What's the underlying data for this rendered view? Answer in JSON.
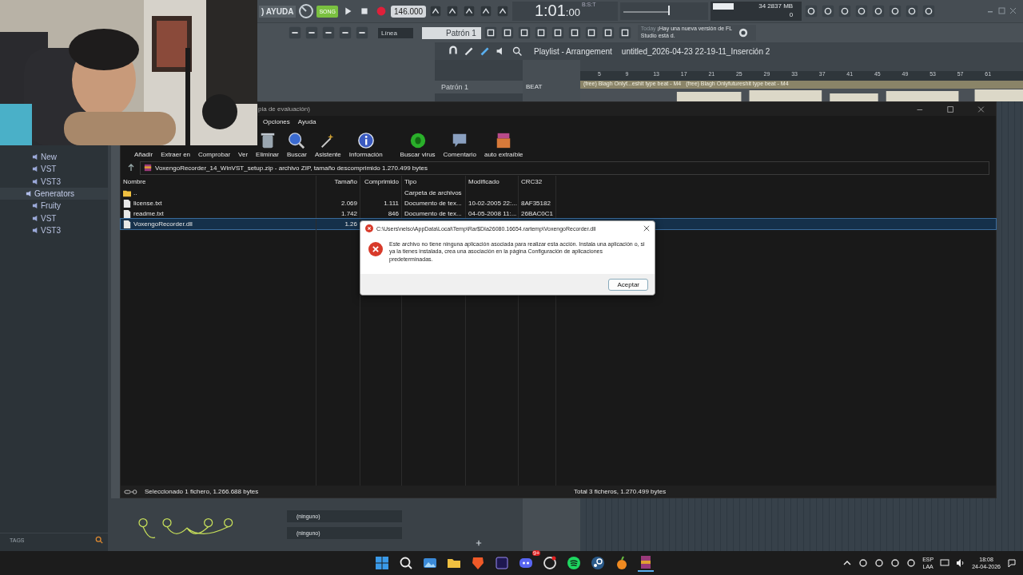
{
  "fl_studio": {
    "menu_tail": ") AYUDA",
    "song_mode": "SONG",
    "tempo": "146.000",
    "time": "1:01",
    "time_ticks": ":00",
    "time_unit": "B:S:T",
    "cpu": "34",
    "memory": "2837 MB",
    "polyphony": "0",
    "snap": "Línea",
    "pattern": "Patrón 1",
    "news_label": "Today",
    "news": "¡Hay una nueva versión de FL Studio está d.",
    "playlist_title": "Playlist - Arrangement",
    "project": "untitled_2026-04-23 22-19-11_Inserción 2",
    "ruler": [
      "5",
      "9",
      "13",
      "17",
      "21",
      "25",
      "29",
      "33",
      "37",
      "41",
      "45",
      "49",
      "53",
      "57",
      "61"
    ],
    "patterns": [
      "Patrón 1"
    ],
    "track": "BEAT",
    "clips": [
      "(free) Blagh  Onlyf...eshit type beat - M4",
      "(free) Blagh  Onlyfutureshit type beat - M4"
    ],
    "browser": {
      "partial_children": [
        "New",
        "VST",
        "VST3"
      ],
      "groups": [
        {
          "label": "Generators",
          "selected": true,
          "children": [
            "Fruity",
            "VST",
            "VST3"
          ]
        }
      ],
      "tags_label": "TAGS"
    },
    "channel_slots": [
      "(ninguno)",
      "(ninguno)"
    ]
  },
  "winrar": {
    "title": "pia de evaluación)",
    "menu": [
      "Opciones",
      "Ayuda"
    ],
    "toolbar": [
      {
        "label": "Añadir",
        "kind": "add"
      },
      {
        "label": "Extraer en",
        "kind": "extract"
      },
      {
        "label": "Comprobar",
        "kind": "test"
      },
      {
        "label": "Ver",
        "kind": "view"
      },
      {
        "label": "Eliminar",
        "kind": "delete"
      },
      {
        "label": "Buscar",
        "kind": "find"
      },
      {
        "label": "Asistente",
        "kind": "wizard"
      },
      {
        "label": "Información",
        "kind": "info"
      },
      {
        "label": "Buscar virus",
        "kind": "virus"
      },
      {
        "label": "Comentario",
        "kind": "comment"
      },
      {
        "label": "auto extraíble",
        "kind": "sfx"
      }
    ],
    "path": "VoxengoRecorder_14_WinVST_setup.zip - archivo ZIP, tamaño descomprimido 1.270.499 bytes",
    "columns": [
      "Nombre",
      "Tamaño",
      "Comprimido",
      "Tipo",
      "Modificado",
      "CRC32"
    ],
    "rows": [
      {
        "kind": "folder",
        "name": "..",
        "type": "Carpeta de archivos",
        "selected": false
      },
      {
        "kind": "file",
        "name": "license.txt",
        "size": "2.069",
        "packed": "1.111",
        "type": "Documento de tex...",
        "modified": "10-02-2005 22:...",
        "crc": "8AF35182",
        "selected": false
      },
      {
        "kind": "file",
        "name": "readme.txt",
        "size": "1.742",
        "packed": "846",
        "type": "Documento de tex...",
        "modified": "04-05-2008 11:...",
        "crc": "26BAC0C1",
        "selected": false
      },
      {
        "kind": "file",
        "name": "VoxengoRecorder.dll",
        "size": "1.26",
        "selected": true
      }
    ],
    "status_left": "Seleccionado 1 fichero, 1.266.688 bytes",
    "status_right": "Total 3 ficheros, 1.270.499 bytes"
  },
  "dialog": {
    "title": "C:\\Users\\nelso\\AppData\\Local\\Temp\\Rar$DIa26080.16654.rartemp\\VoxengoRecorder.dll",
    "message": "Este archivo no tiene ninguna aplicación asociada para realizar esta acción. Instala una aplicación o, si ya la tienes instalada, crea una asociación en la página Configuración de aplicaciones predeterminadas.",
    "button": "Aceptar"
  },
  "taskbar": {
    "badge": "9+",
    "language": "ESP",
    "layout": "LAA",
    "time": "18:08",
    "date": "24-04-2026"
  }
}
